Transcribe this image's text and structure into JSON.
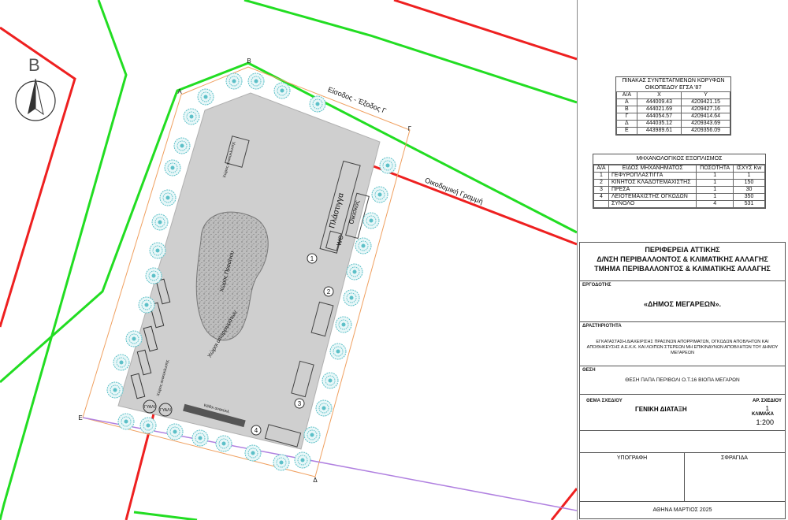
{
  "north": {
    "letter": "B"
  },
  "vertices": {
    "a": "A",
    "b": "B",
    "g": "Γ",
    "d": "Δ",
    "e": "E"
  },
  "plan_labels": {
    "entrance": "Είσοδος - Έξοδος Γ",
    "building_line": "Οικοδομική Γραμμή",
    "platform": "Πλάστιγγα",
    "office": "Οικίσκος",
    "wc": "WC",
    "green_storage": "Χώρος Πρασίνου",
    "waste_area": "Χώροι απορριμμάτων",
    "storage_left": "Χώρος ανακύκλωσης",
    "bins": "Κάδοι ανακύκλ.",
    "tank_1": "ΓΥΑΛΙ",
    "tank_2": "ΓΥΑΛΙ",
    "machine_numbers": [
      "1",
      "2",
      "3",
      "4"
    ]
  },
  "colors": {
    "road_green": "#22dd22",
    "road_red": "#ee2020",
    "site_grey": "#cfcfcf",
    "boundary_orange": "#f0a060",
    "purple_line": "#b080e0",
    "tree": "#5cc0c8"
  },
  "coords_table": {
    "title_1": "ΠΙΝΑΚΑΣ ΣΥΝΤΕΤΑΓΜΕΝΩΝ ΚΟΡΥΦΩΝ",
    "title_2": "ΟΙΚΟΠΕΔΟΥ ΕΓΣΑ '87",
    "headers": [
      "Α/Α",
      "X",
      "Y"
    ],
    "rows": [
      [
        "Α",
        "444009.43",
        "4209421.15"
      ],
      [
        "Β",
        "444021.69",
        "4209427.16"
      ],
      [
        "Γ",
        "444054.57",
        "4209414.64"
      ],
      [
        "Δ",
        "444035.12",
        "4209343.69"
      ],
      [
        "Ε",
        "443989.61",
        "4209356.09"
      ]
    ]
  },
  "equipment_table": {
    "title": "ΜΗΧΑΝΟΛΟΓΙΚΟΣ ΕΞΟΠΛΙΣΜΟΣ",
    "headers": [
      "Α/Α",
      "ΕΙΔΟΣ ΜΗΧΑΝΗΜΑΤΟΣ",
      "ΠΟΣΟΤΗΤΑ",
      "ΙΣΧΥΣ Kw"
    ],
    "rows": [
      [
        "1",
        "ΓΕΦΥΡΟΠΛΑΣΤΙΓΓΑ",
        "1",
        "1"
      ],
      [
        "2",
        "ΚΙΝΗΤΟΣ ΚΛΑΔΟΤΕΜΑΧΙΣΤΗΣ",
        "1",
        "150"
      ],
      [
        "3",
        "ΠΡΕΣΑ",
        "1",
        "30"
      ],
      [
        "4",
        "ΛΕΙΟΤΕΜΑΧΙΣΤΗΣ ΟΓΚΩΔΩΝ",
        "1",
        "350"
      ],
      [
        "",
        "ΣΥΝΟΛΟ",
        "4",
        "531"
      ]
    ]
  },
  "title_block": {
    "authority_1": "ΠΕΡΙΦΕΡΕΙΑ ΑΤΤΙΚΗΣ",
    "authority_2": "Δ/ΝΣΗ ΠΕΡΙΒΑΛΛΟΝΤΟΣ & ΚΛΙΜΑΤΙΚΗΣ ΑΛΛΑΓΗΣ",
    "authority_3": "ΤΜΗΜΑ ΠΕΡΙΒΑΛΛΟΝΤΟΣ & ΚΛΙΜΑΤΙΚΗΣ ΑΛΛΑΓΗΣ",
    "owner_label": "ΕΡΓΟΔΟΤΗΣ",
    "owner_value": "«ΔΗΜΟΣ ΜΕΓΑΡΕΩΝ».",
    "activity_label": "ΔΡΑΣΤΗΡΙΟΤΗΤΑ",
    "activity_value": "ΕΓΚΑΤΑΣΤΑΣΗ ΔΙΑΧΕΙΡΙΣΗΣ ΠΡΑΣΙΝΩΝ ΑΠΟΡΡΙΜΑΤΩΝ, ΟΓΚΩΔΩΝ ΑΠΟΒΛΗΤΩΝ ΚΑΙ ΑΠΟΘΗΚΕΥΣΗΣ Α.Ε.Κ.Κ. ΚΑΙ ΛΟΙΠΩΝ ΣΤΕΡΕΩΝ ΜΗ ΕΠΙΚΙΝΔΥΝΩΝ ΑΠΟΒΛΗΤΩΝ ΤΟΥ ΔΗΜΟΥ ΜΕΓΑΡΕΩΝ",
    "location_label": "ΘΕΣΗ",
    "location_value": "ΘΕΣΗ ΠΑΠΑ ΠΕΡΙΒΟΛΙ Ο.Τ.16 ΒΙΟΠΑ ΜΕΓΑΡΩΝ",
    "subject_label": "ΘΕΜΑ ΣΧΕΔΙΟΥ",
    "subject_value": "ΓΕΝΙΚΗ ΔΙΑΤΑΞΗ",
    "drawing_no_label": "ΑΡ. ΣΧΕΔΙΟΥ",
    "drawing_no_value": "1",
    "scale_label": "ΚΛΙΜΑΚΑ",
    "scale_value": "1:200",
    "signature_label": "ΥΠΟΓΡΑΦΗ",
    "stamp_label": "ΣΦΡΑΓΙΔΑ",
    "place_date": "ΑΘΗΝΑ ΜΑΡΤΙΟΣ 2025"
  }
}
